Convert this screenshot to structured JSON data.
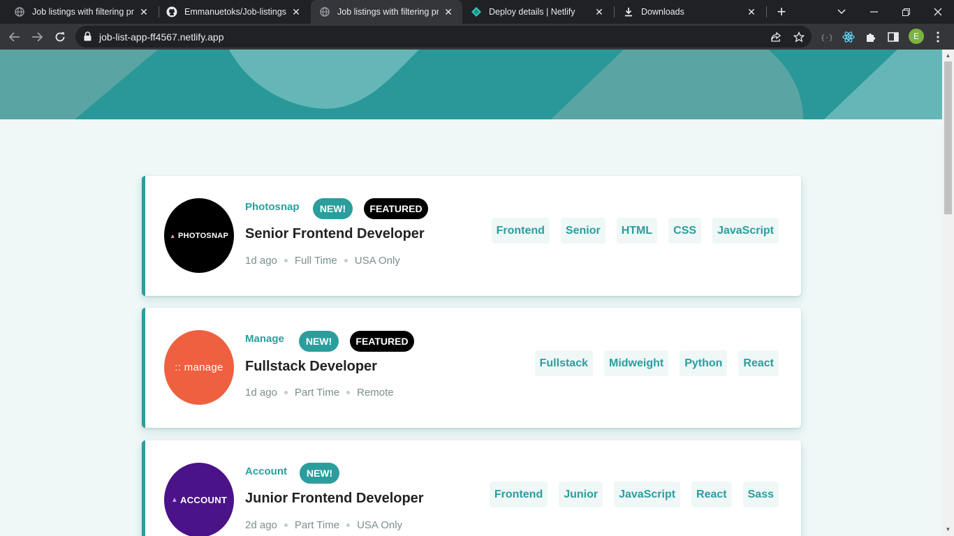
{
  "browser": {
    "tabs": [
      {
        "title": "Job listings with filtering proj",
        "icon": "globe-icon",
        "active": false
      },
      {
        "title": "Emmanuetoks/Job-listings-w",
        "icon": "github-icon",
        "active": false
      },
      {
        "title": "Job listings with filtering proj",
        "icon": "globe-icon",
        "active": true
      },
      {
        "title": "Deploy details | Netlify",
        "icon": "netlify-icon",
        "active": false
      },
      {
        "title": "Downloads",
        "icon": "download-icon",
        "active": false
      }
    ],
    "url": "job-list-app-ff4567.netlify.app",
    "profile_initial": "E"
  },
  "theme": {
    "primary": "#5ba4a4",
    "dark": "#2c9d9d",
    "background": "#eff7f7"
  },
  "jobs": [
    {
      "company": "Photosnap",
      "logo_text": "PHOTOSNAP",
      "logo_color": "#000000",
      "new": "NEW!",
      "featured": "FEATURED",
      "position": "Senior Frontend Developer",
      "posted": "1d ago",
      "contract": "Full Time",
      "location": "USA Only",
      "tags": [
        "Frontend",
        "Senior",
        "HTML",
        "CSS",
        "JavaScript"
      ]
    },
    {
      "company": "Manage",
      "logo_text": ":: manage",
      "logo_color": "#ef6040",
      "new": "NEW!",
      "featured": "FEATURED",
      "position": "Fullstack Developer",
      "posted": "1d ago",
      "contract": "Part Time",
      "location": "Remote",
      "tags": [
        "Fullstack",
        "Midweight",
        "Python",
        "React"
      ]
    },
    {
      "company": "Account",
      "logo_text": "ACCOUNT",
      "logo_color": "#4b1388",
      "new": "NEW!",
      "featured": null,
      "position": "Junior Frontend Developer",
      "posted": "2d ago",
      "contract": "Part Time",
      "location": "USA Only",
      "tags": [
        "Frontend",
        "Junior",
        "JavaScript",
        "React",
        "Sass"
      ]
    }
  ]
}
